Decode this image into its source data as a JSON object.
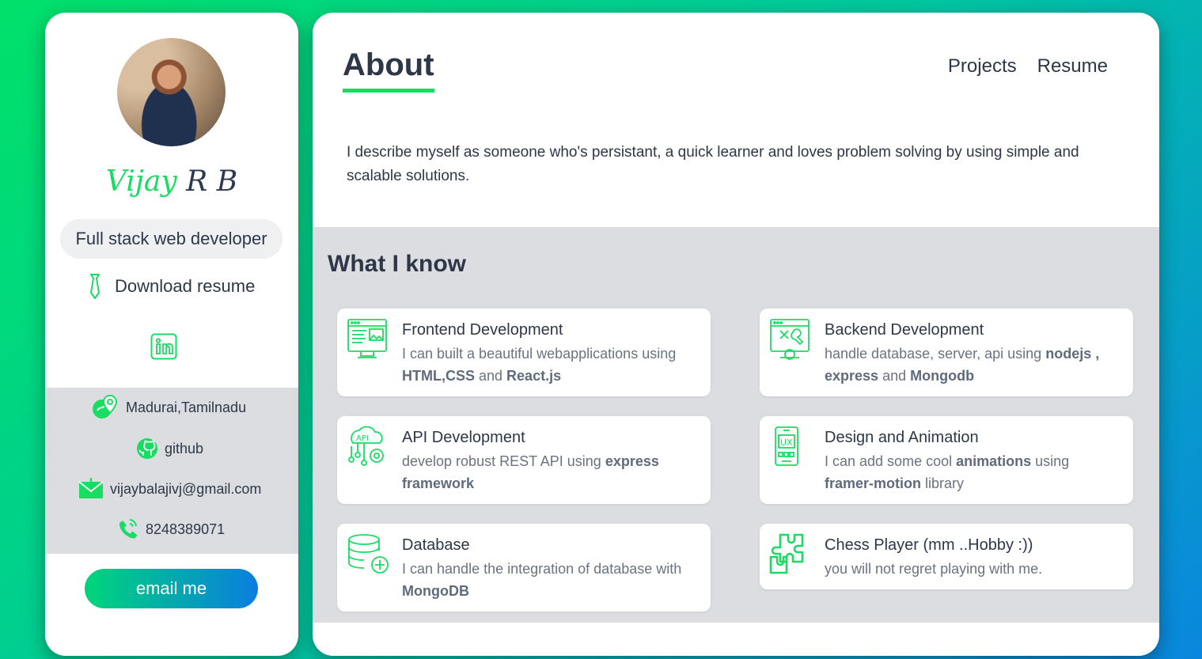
{
  "sidebar": {
    "name_first": "Vijay",
    "name_last": "R B",
    "role": "Full stack web developer",
    "download_label": "Download resume",
    "contacts": {
      "location": "Madurai,Tamilnadu",
      "github": "github",
      "email": "vijaybalajivj@gmail.com",
      "phone": "8248389071"
    },
    "email_button": "email me"
  },
  "main": {
    "title": "About",
    "nav": [
      "Projects",
      "Resume"
    ],
    "intro": "I describe myself as someone who's persistant, a quick learner and loves problem solving by using simple and scalable solutions.",
    "skills_title": "What I know",
    "skills": [
      {
        "title": "Frontend Development",
        "desc_1": "I can built a beautiful webapplications using ",
        "bold_1": "HTML,CSS",
        "desc_2": " and ",
        "bold_2": "React.js",
        "desc_3": ""
      },
      {
        "title": "Backend Development",
        "desc_1": "handle database, server, api using ",
        "bold_1": "nodejs , express",
        "desc_2": " and ",
        "bold_2": "Mongodb",
        "desc_3": ""
      },
      {
        "title": "API Development",
        "desc_1": "develop robust REST API using ",
        "bold_1": "express framework",
        "desc_2": "",
        "bold_2": "",
        "desc_3": ""
      },
      {
        "title": "Design and Animation",
        "desc_1": "I can add some cool ",
        "bold_1": "animations",
        "desc_2": " using ",
        "bold_2": "framer-motion",
        "desc_3": " library"
      },
      {
        "title": "Database",
        "desc_1": "I can handle the integration of database with ",
        "bold_1": "MongoDB",
        "desc_2": "",
        "bold_2": "",
        "desc_3": ""
      },
      {
        "title": "Chess Player (mm ..Hobby :))",
        "desc_1": "you will not regret playing with me.",
        "bold_1": "",
        "desc_2": "",
        "bold_2": "",
        "desc_3": ""
      }
    ]
  },
  "colors": {
    "accent": "#19dc63",
    "text": "#2d3748",
    "muted": "#6b7280",
    "panel_gray": "#dcdde0"
  },
  "icons": [
    "tie-icon",
    "linkedin-icon",
    "location-icon",
    "github-icon",
    "mail-icon",
    "phone-icon",
    "frontend-icon",
    "backend-icon",
    "api-icon",
    "design-icon",
    "database-icon",
    "puzzle-icon"
  ]
}
